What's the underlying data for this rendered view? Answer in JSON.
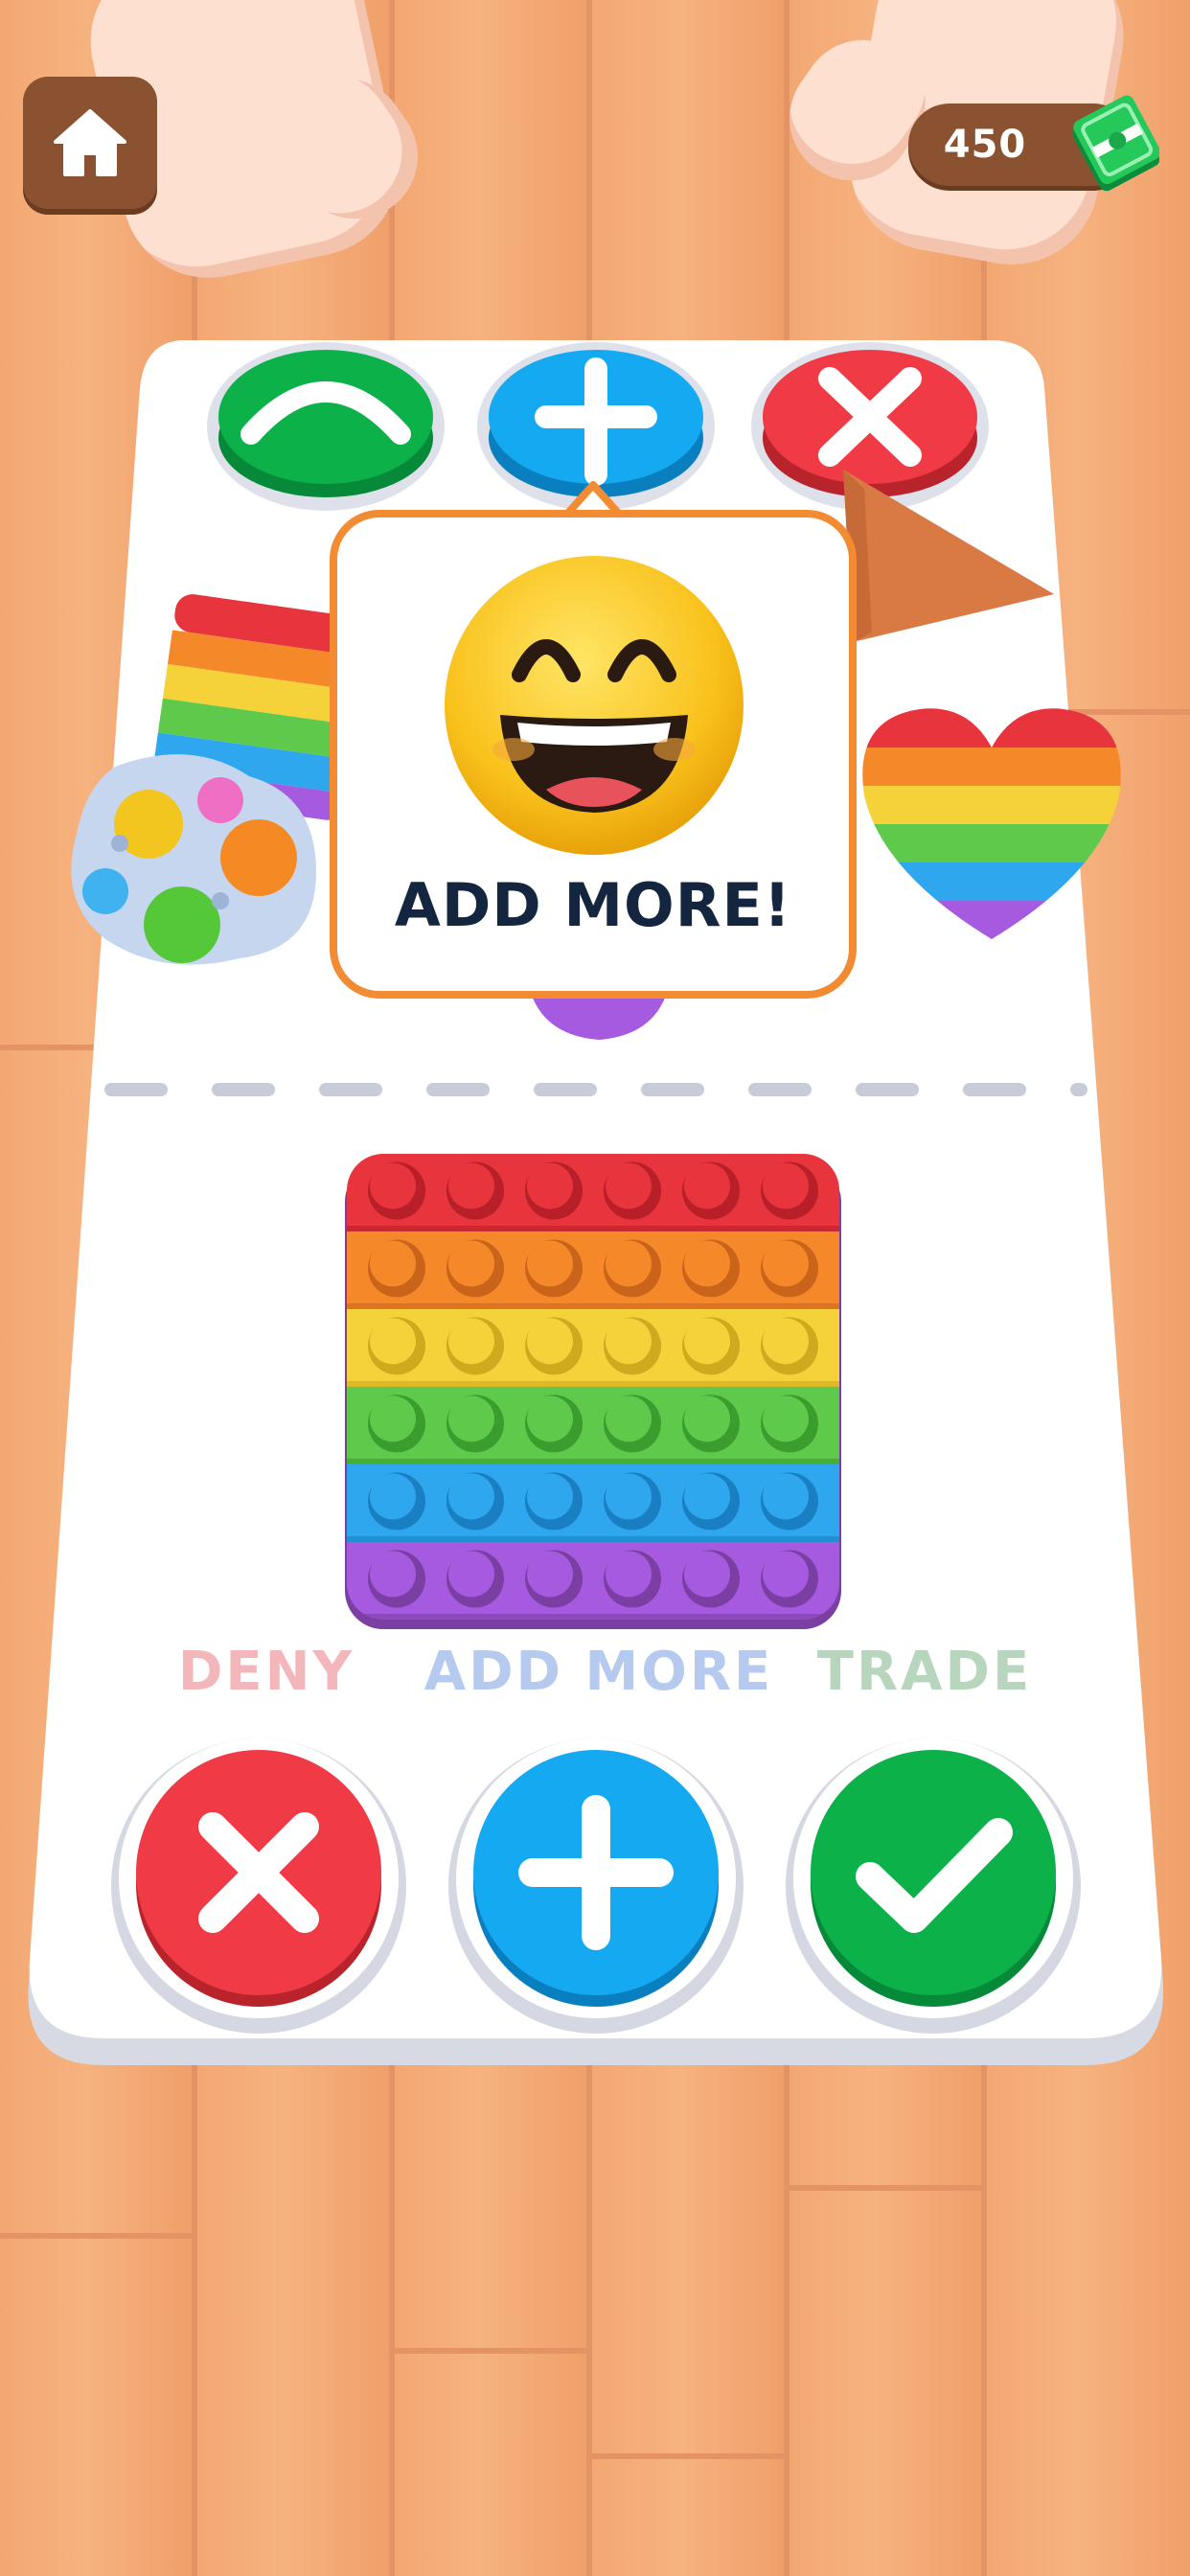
{
  "hud": {
    "home_icon": "home-icon",
    "currency": "450",
    "currency_icon": "cash-icon"
  },
  "popup": {
    "text": "ADD MORE!",
    "icon": "grinning-emoji-icon"
  },
  "actions": {
    "deny": {
      "label": "DENY",
      "icon": "close-icon",
      "color": "#f03b46"
    },
    "add_more": {
      "label": "ADD MORE",
      "icon": "plus-icon",
      "color": "#15a9f1"
    },
    "trade": {
      "label": "TRADE",
      "icon": "check-icon",
      "color": "#0cb14a"
    }
  },
  "opponent_buttons": [
    {
      "icon": "caret-up-icon",
      "color": "#0cb14a"
    },
    {
      "icon": "plus-icon",
      "color": "#15a9f1"
    },
    {
      "icon": "close-icon",
      "color": "#f03b46"
    }
  ],
  "colors": {
    "board": "#ffffff",
    "wood": "#f3a873",
    "hud_brown": "#8a5230",
    "popup_border": "#f28b32",
    "popup_text": "#14263f"
  }
}
